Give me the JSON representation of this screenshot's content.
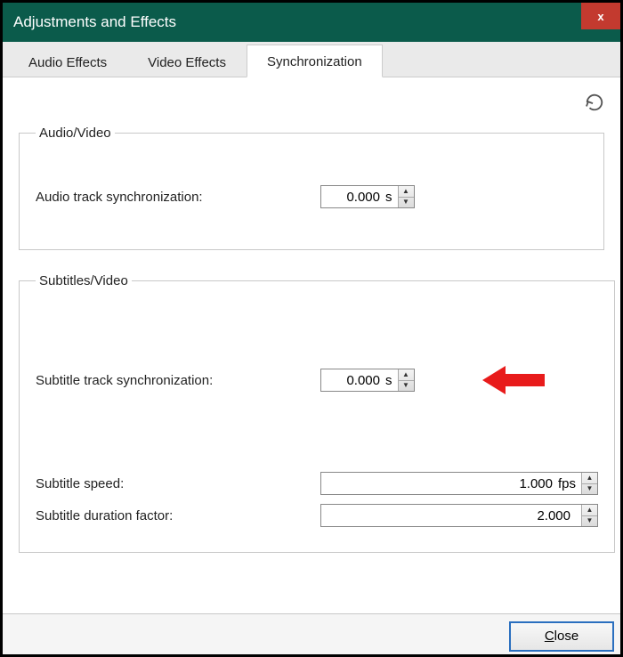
{
  "window": {
    "title": "Adjustments and Effects",
    "close_glyph": "x"
  },
  "tabs": {
    "audio_effects": "Audio Effects",
    "video_effects": "Video Effects",
    "synchronization": "Synchronization"
  },
  "sync": {
    "audio_video_legend": "Audio/Video",
    "audio_track_sync_label": "Audio track synchronization:",
    "audio_track_sync_value": "0.000",
    "audio_track_sync_unit": "s",
    "subtitles_video_legend": "Subtitles/Video",
    "subtitle_track_sync_label": "Subtitle track synchronization:",
    "subtitle_track_sync_value": "0.000",
    "subtitle_track_sync_unit": "s",
    "subtitle_speed_label": "Subtitle speed:",
    "subtitle_speed_value": "1.000",
    "subtitle_speed_unit": "fps",
    "subtitle_duration_factor_label": "Subtitle duration factor:",
    "subtitle_duration_factor_value": "2.000"
  },
  "footer": {
    "close_prefix": "C",
    "close_rest": "lose"
  }
}
